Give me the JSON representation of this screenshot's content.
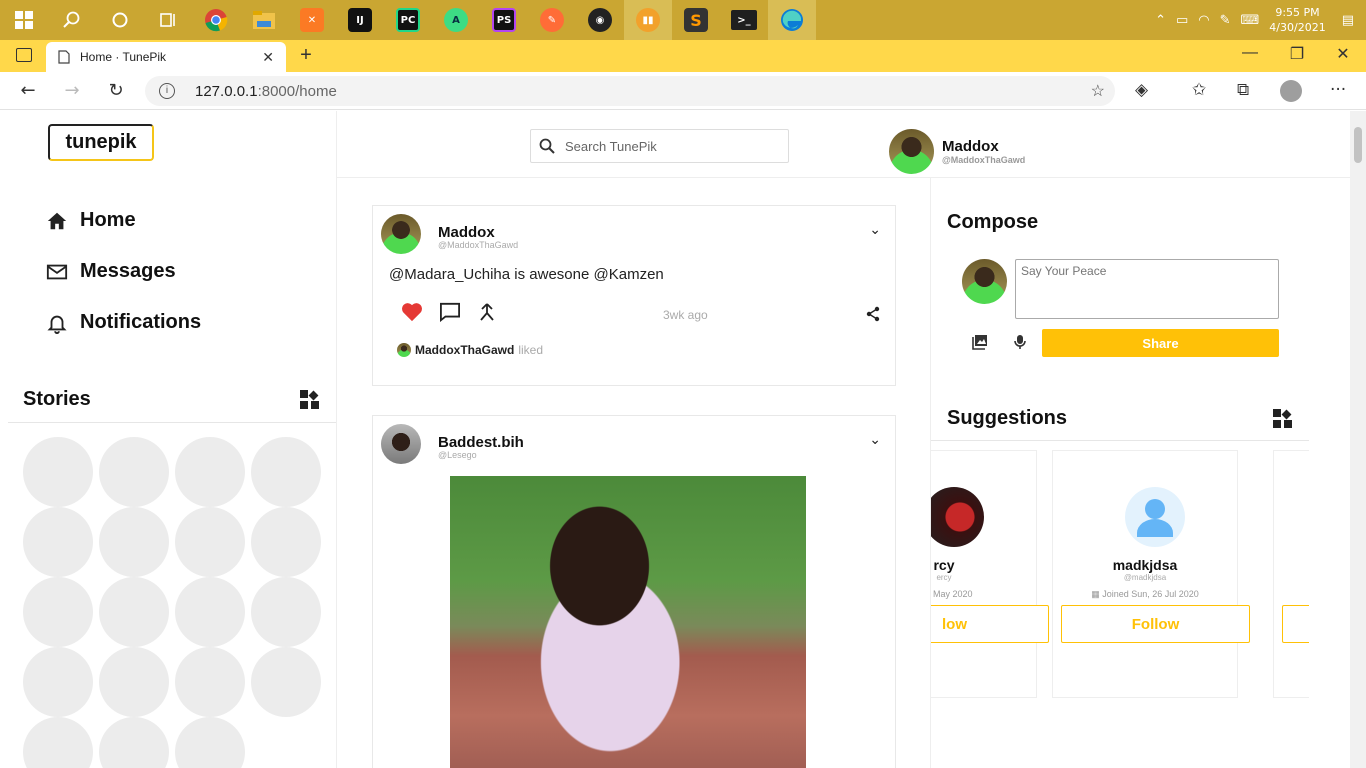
{
  "taskbar": {
    "apps": [
      "windows-start-icon",
      "search-icon",
      "cortana-icon",
      "task-view-icon",
      "chrome-icon",
      "file-explorer-icon",
      "xampp-icon",
      "intellij-icon",
      "pycharm-icon",
      "android-studio-icon",
      "phpstorm-icon",
      "postman-icon",
      "music-player-icon",
      "power-bi-icon",
      "sublime-text-icon",
      "terminal-icon",
      "edge-icon"
    ],
    "app_labels": {
      "intellij": "IJ",
      "pycharm": "PC",
      "phpstorm": "PS"
    },
    "clock_time": "9:55 PM",
    "clock_date": "4/30/2021"
  },
  "browser": {
    "tab_title": "Home · TunePik",
    "url_host": "127.0.0.1",
    "url_rest": ":8000/home"
  },
  "app": {
    "logo": "tunepik",
    "nav": [
      {
        "label": "Home",
        "icon": "home-icon"
      },
      {
        "label": "Messages",
        "icon": "mail-icon"
      },
      {
        "label": "Notifications",
        "icon": "bell-icon"
      }
    ],
    "stories_title": "Stories",
    "search_placeholder": "Search TunePik",
    "me": {
      "name": "Maddox",
      "handle": "@MaddoxThaGawd"
    }
  },
  "feed": {
    "posts": [
      {
        "name": "Maddox",
        "handle": "@MaddoxThaGawd",
        "text": "@Madara_Uchiha is awesone @Kamzen",
        "time": "3wk ago",
        "liked_by": "MaddoxThaGawd",
        "liked_verb": "liked"
      },
      {
        "name": "Baddest.bih",
        "handle": "@Lesego"
      }
    ]
  },
  "compose": {
    "title": "Compose",
    "placeholder": "Say Your Peace",
    "share_label": "Share"
  },
  "suggestions": {
    "title": "Suggestions",
    "cards": [
      {
        "name": "rcy",
        "handle": "ercy",
        "joined": ", 14 May 2020",
        "follow": "low"
      },
      {
        "name": "madkjdsa",
        "handle": "@madkjdsa",
        "joined": "Joined Sun, 26 Jul 2020",
        "follow": "Follow"
      }
    ]
  },
  "colors": {
    "accent": "#ffc107",
    "taskbar": "#caa632",
    "tabstrip": "#ffd84a",
    "like": "#e53935"
  }
}
